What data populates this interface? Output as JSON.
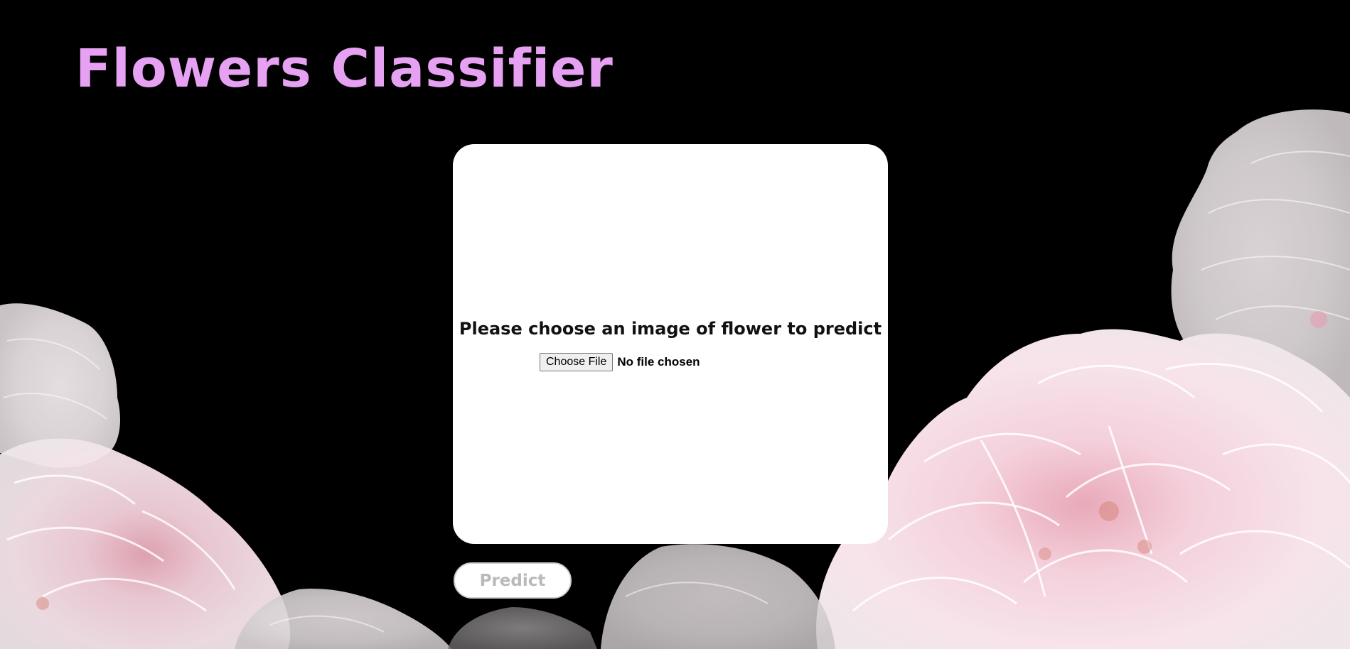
{
  "header": {
    "title": "Flowers Classifier"
  },
  "upload_card": {
    "prompt": "Please choose an image of flower to predict",
    "choose_file_label": "Choose File",
    "file_status": "No file chosen"
  },
  "actions": {
    "predict_label": "Predict"
  },
  "colors": {
    "background": "#000000",
    "title": "#e6a1f2",
    "card": "#ffffff",
    "predict_text": "#b9b9b9",
    "flower_pink": "#f3d6e0"
  },
  "decor": {
    "background_image": "pink-flowers-illustration"
  }
}
